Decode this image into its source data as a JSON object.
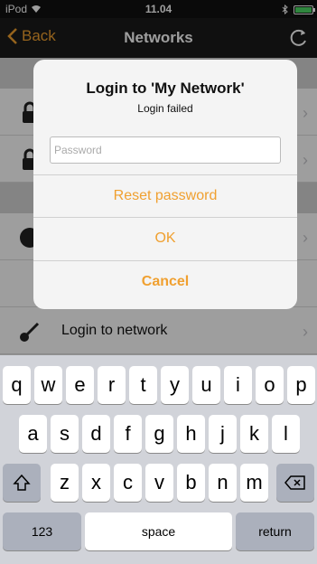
{
  "status_bar": {
    "carrier": "iPod",
    "time": "11.04"
  },
  "nav": {
    "back_label": "Back",
    "title": "Networks"
  },
  "list": {
    "login_row_label": "Login to network"
  },
  "alert": {
    "title": "Login to 'My Network'",
    "message": "Login failed",
    "password_placeholder": "Password",
    "reset_label": "Reset password",
    "ok_label": "OK",
    "cancel_label": "Cancel"
  },
  "keyboard": {
    "row1": [
      "q",
      "w",
      "e",
      "r",
      "t",
      "y",
      "u",
      "i",
      "o",
      "p"
    ],
    "row2": [
      "a",
      "s",
      "d",
      "f",
      "g",
      "h",
      "j",
      "k",
      "l"
    ],
    "row3": [
      "z",
      "x",
      "c",
      "v",
      "b",
      "n",
      "m"
    ],
    "numbers_label": "123",
    "space_label": "space",
    "return_label": "return"
  },
  "colors": {
    "accent": "#f0a030",
    "nav_bg": "#1a1a1a",
    "keyboard_bg": "#d1d3d9"
  }
}
